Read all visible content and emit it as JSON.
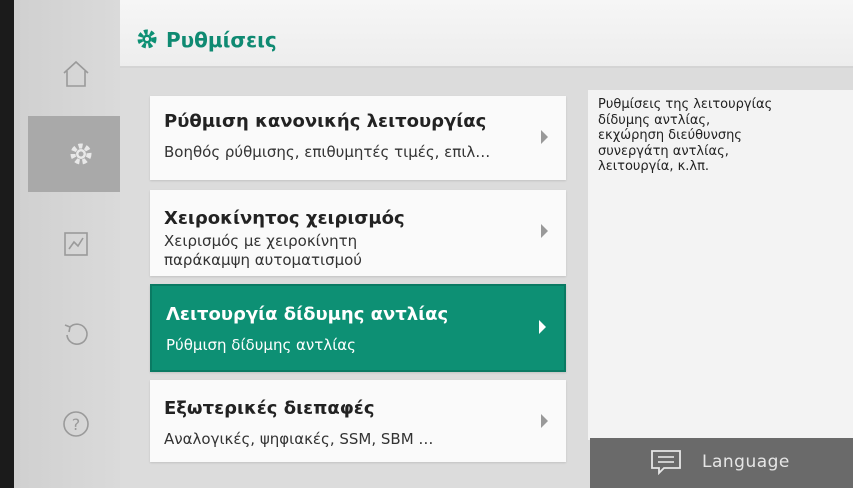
{
  "header": {
    "title": "Ρυθμίσεις",
    "icon": "gear-icon",
    "accent_color": "#0d9074"
  },
  "sidebar": {
    "items": [
      {
        "name": "home",
        "icon": "home-icon",
        "active": false
      },
      {
        "name": "settings",
        "icon": "settings-icon",
        "active": true
      },
      {
        "name": "diagnostics",
        "icon": "chart-icon",
        "active": false
      },
      {
        "name": "restore",
        "icon": "restore-icon",
        "active": false
      },
      {
        "name": "help",
        "icon": "help-icon",
        "active": false
      }
    ]
  },
  "menu": [
    {
      "title": "Ρύθμιση κανονικής λειτουργίας",
      "subtitle": "Βοηθός ρύθμισης, επιθυμητές τιμές, επιλ…",
      "selected": false
    },
    {
      "title": "Χειροκίνητος χειρισμός",
      "subtitle": "Χειρισμός με χειροκίνητη παράκαμψη αυτοματισμού",
      "selected": false
    },
    {
      "title": "Λειτουργία δίδυμης αντλίας",
      "subtitle": "Ρύθμιση δίδυμης αντλίας",
      "selected": true
    },
    {
      "title": "Εξωτερικές διεπαφές",
      "subtitle": "Αναλογικές, ψηφιακές, SSM, SBM …",
      "selected": false
    }
  ],
  "info": {
    "text": "Ρυθμίσεις της λειτουργίας\nδίδυμης αντλίας,\nεκχώρηση διεύθυνσης\nσυνεργάτη αντλίας,\nλειτουργία, κ.λπ."
  },
  "language": {
    "label": "Language",
    "icon": "chat-icon"
  }
}
